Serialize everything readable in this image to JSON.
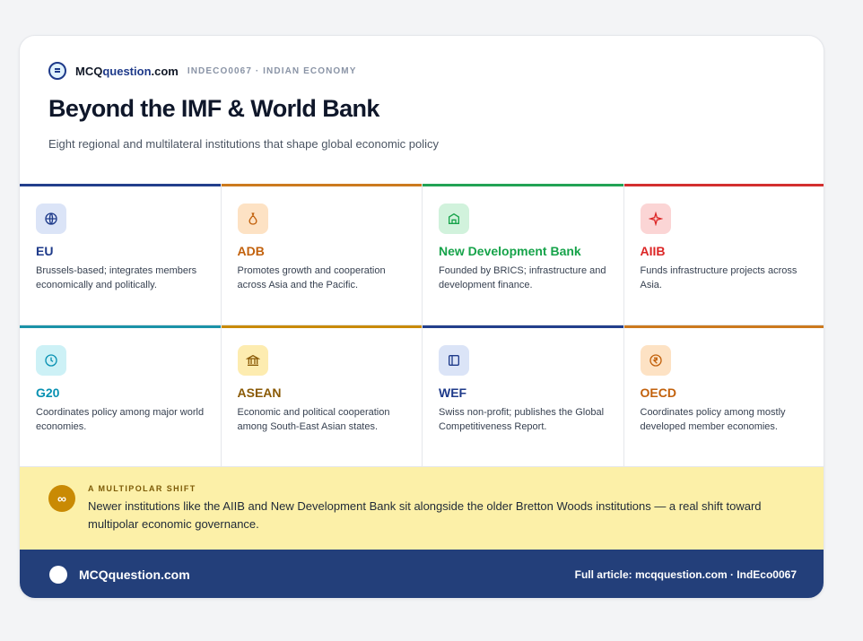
{
  "header": {
    "brand": {
      "prefix": "MCQ",
      "accent": "question",
      "suffix": ".com"
    },
    "code": "INDECO0067 · INDIAN ECONOMY",
    "title": "Beyond the IMF & World Bank",
    "subtitle": "Eight regional and multilateral institutions that shape global economic policy"
  },
  "institutions": [
    {
      "name": "EU",
      "desc": "Brussels-based; integrates members economically and politically.",
      "icon": "globe-icon",
      "color": "#1e3a8a",
      "bg": "#dbe4f7",
      "bar": "#233f8c"
    },
    {
      "name": "ADB",
      "desc": "Promotes growth and cooperation across Asia and the Pacific.",
      "icon": "growth-icon",
      "color": "#c2610c",
      "bg": "#fde2c4",
      "bar": "#cc7a1e"
    },
    {
      "name": "New Development Bank",
      "desc": "Founded by BRICS; infrastructure and development finance.",
      "icon": "bank-building-icon",
      "color": "#16a34a",
      "bg": "#d1f2dc",
      "bar": "#22a355"
    },
    {
      "name": "AIIB",
      "desc": "Funds infrastructure projects across Asia.",
      "icon": "sparkle-icon",
      "color": "#dc2626",
      "bg": "#fbd5d5",
      "bar": "#d32f2f"
    },
    {
      "name": "G20",
      "desc": "Coordinates policy among major world economies.",
      "icon": "clock-icon",
      "color": "#0891b2",
      "bg": "#cdf1f6",
      "bar": "#1b93a8"
    },
    {
      "name": "ASEAN",
      "desc": "Economic and political cooperation among South-East Asian states.",
      "icon": "institution-icon",
      "color": "#8a5a06",
      "bg": "#fdecb0",
      "bar": "#c98a04"
    },
    {
      "name": "WEF",
      "desc": "Swiss non-profit; publishes the Global Competitiveness Report.",
      "icon": "report-icon",
      "color": "#1e3a8a",
      "bg": "#dbe4f7",
      "bar": "#233f8c"
    },
    {
      "name": "OECD",
      "desc": "Coordinates policy among mostly developed member economies.",
      "icon": "rupee-coin-icon",
      "color": "#c2610c",
      "bg": "#fde2c4",
      "bar": "#cc7a1e"
    }
  ],
  "shift": {
    "label": "A MULTIPOLAR SHIFT",
    "text": "Newer institutions like the AIIB and New Development Bank sit alongside the older Bretton Woods institutions — a real shift toward multipolar economic governance.",
    "icon": "infinity-icon"
  },
  "footer": {
    "brand": "MCQquestion.com",
    "link": "Full article: mcqquestion.com · IndEco0067"
  },
  "colors": {
    "footer_bg": "#233f7a",
    "shift_bg": "#fcf0a8",
    "shift_icon": "#c98a04"
  }
}
